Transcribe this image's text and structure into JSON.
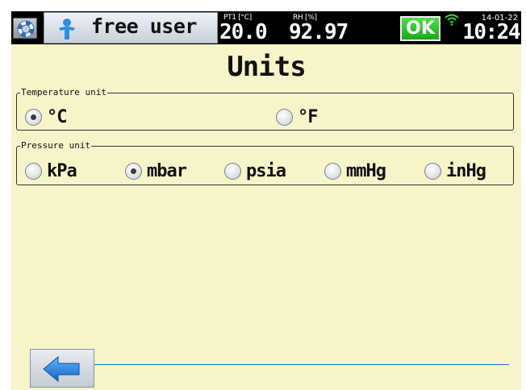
{
  "header": {
    "user_label": "free user",
    "measurements": [
      {
        "label": "PT1 [°C]",
        "value": "20.0"
      },
      {
        "label": "RH [%]",
        "value": "92.97"
      }
    ],
    "status": "OK",
    "date": "14-01-22",
    "time": "10:24",
    "icons": [
      "lifebuoy-icon",
      "user-icon",
      "wifi-icon"
    ]
  },
  "page": {
    "title": "Units"
  },
  "temperature": {
    "legend": "Temperature unit",
    "options": [
      "°C",
      "°F"
    ],
    "selected": "°C"
  },
  "pressure": {
    "legend": "Pressure unit",
    "options": [
      "kPa",
      "mbar",
      "psia",
      "mmHg",
      "inHg"
    ],
    "selected": "mbar"
  },
  "footer": {
    "back_icon": "back-arrow-icon"
  },
  "colors": {
    "background": "#f6f4c9",
    "topbar": "#000000",
    "ok_green": "#22b522",
    "accent_blue": "#1a6fb5"
  }
}
